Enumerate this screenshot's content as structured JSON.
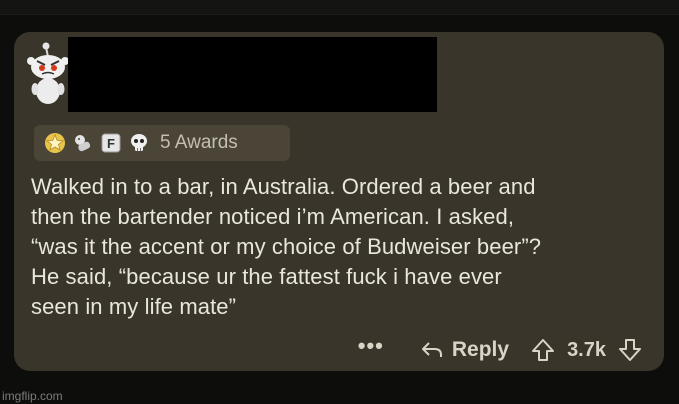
{
  "awards": {
    "icons": [
      "star-badge-icon",
      "wholesome-icon",
      "f-key-icon",
      "skull-icon"
    ],
    "label": "5 Awards"
  },
  "comment": {
    "lines": [
      "Walked in to a bar, in Australia.  Ordered a beer and",
      "then the bartender noticed i’m American.  I asked,",
      "“was it the accent or my choice of Budweiser beer”?",
      "He said, “because ur the fattest fuck i have ever",
      "seen in my life mate”"
    ]
  },
  "actions": {
    "more": "•••",
    "reply": "Reply",
    "score": "3.7k"
  },
  "watermark": "imgflip.com",
  "colors": {
    "background": "#0d0d0c",
    "card": "#39352a",
    "awards_bg": "#4a4537",
    "text": "#e9e6dc"
  }
}
